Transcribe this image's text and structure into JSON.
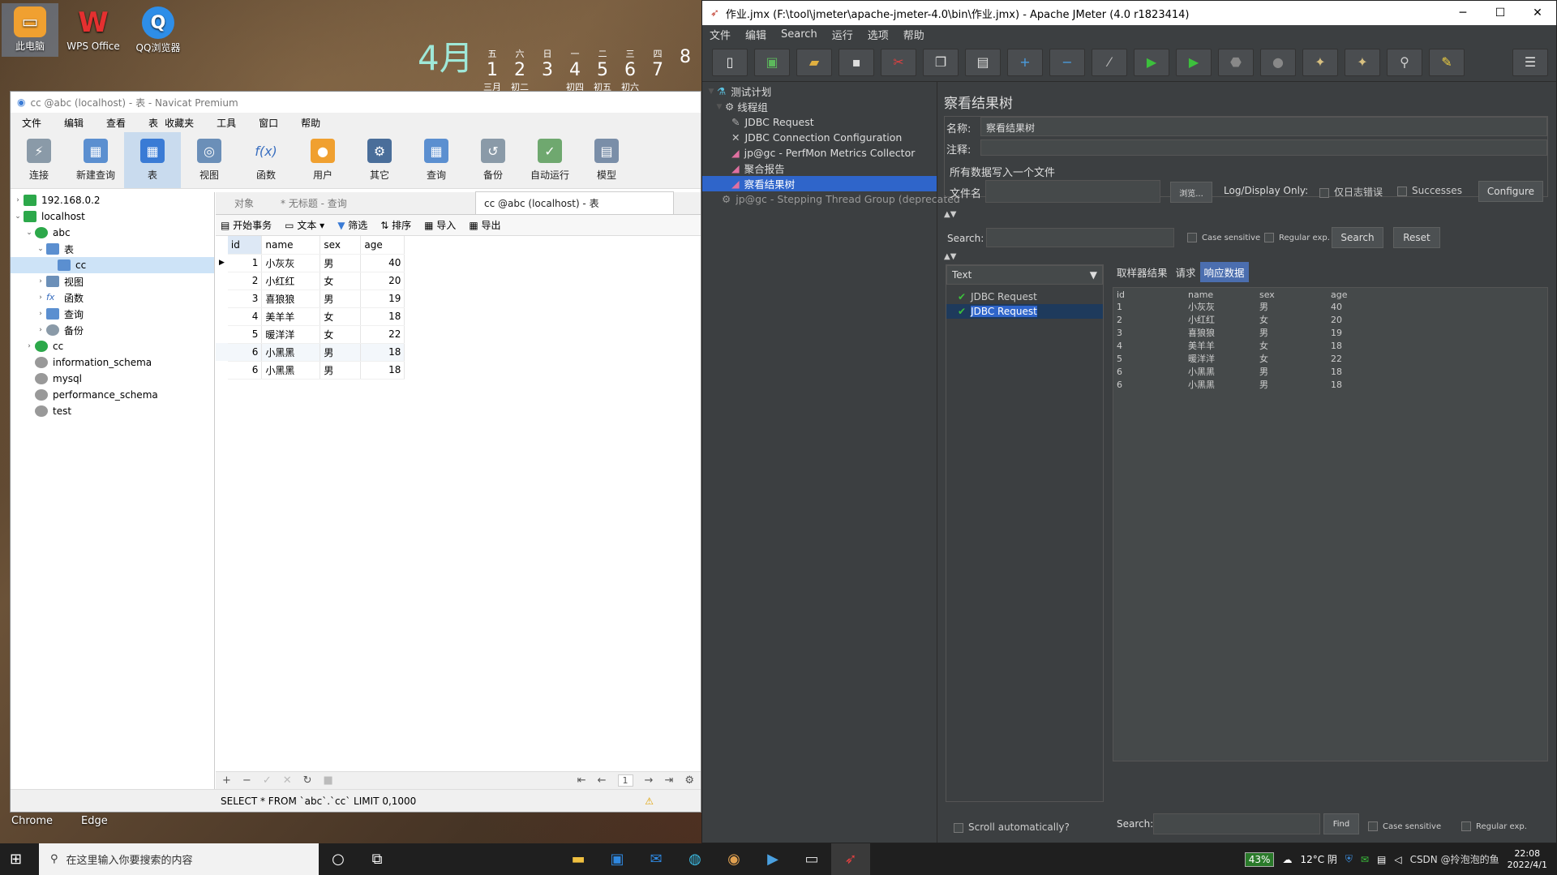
{
  "desktop": {
    "icons": [
      {
        "label": "此电脑"
      },
      {
        "label": "WPS Office"
      },
      {
        "label": "QQ浏览器"
      }
    ],
    "calendar_month": "4月",
    "calendar_days": [
      {
        "top": "五",
        "num": "1",
        "sub": "三月"
      },
      {
        "top": "六",
        "num": "2",
        "sub": "初二"
      },
      {
        "top": "日",
        "num": "3",
        "sub": ""
      },
      {
        "top": "一",
        "num": "4",
        "sub": "初四"
      },
      {
        "top": "二",
        "num": "5",
        "sub": "初五"
      },
      {
        "top": "三",
        "num": "6",
        "sub": "初六"
      },
      {
        "top": "四",
        "num": "7",
        "sub": ""
      },
      {
        "top": "",
        "num": "8",
        "sub": ""
      }
    ],
    "bottom_labels": [
      "Chrome",
      "Edge"
    ]
  },
  "navicat": {
    "title": "cc @abc (localhost) - 表 - Navicat Premium",
    "menu": [
      "文件",
      "编辑",
      "查看",
      "表",
      "收藏夹",
      "工具",
      "窗口",
      "帮助"
    ],
    "tools": [
      "连接",
      "新建查询",
      "表",
      "视图",
      "函数",
      "用户",
      "其它",
      "查询",
      "备份",
      "自动运行",
      "模型"
    ],
    "tree": [
      {
        "label": "192.168.0.2",
        "level": 0,
        "arrow": "›"
      },
      {
        "label": "localhost",
        "level": 0,
        "arrow": "⌄"
      },
      {
        "label": "abc",
        "level": 1,
        "arrow": "⌄"
      },
      {
        "label": "表",
        "level": 2,
        "arrow": "⌄"
      },
      {
        "label": "cc",
        "level": 3,
        "arrow": ""
      },
      {
        "label": "视图",
        "level": 2,
        "arrow": "›"
      },
      {
        "label": "函数",
        "level": 2,
        "arrow": "›"
      },
      {
        "label": "查询",
        "level": 2,
        "arrow": "›"
      },
      {
        "label": "备份",
        "level": 2,
        "arrow": "›"
      },
      {
        "label": "cc",
        "level": 1,
        "arrow": "›"
      },
      {
        "label": "information_schema",
        "level": 1,
        "arrow": ""
      },
      {
        "label": "mysql",
        "level": 1,
        "arrow": ""
      },
      {
        "label": "performance_schema",
        "level": 1,
        "arrow": ""
      },
      {
        "label": "test",
        "level": 1,
        "arrow": ""
      }
    ],
    "tabs": [
      "对象",
      "* 无标题 - 查询",
      "cc @abc (localhost) - 表"
    ],
    "toolbar": [
      "开始事务",
      "文本",
      "筛选",
      "排序",
      "导入",
      "导出"
    ],
    "columns": [
      "id",
      "name",
      "sex",
      "age"
    ],
    "rows": [
      [
        "1",
        "小灰灰",
        "男",
        "40"
      ],
      [
        "2",
        "小红红",
        "女",
        "20"
      ],
      [
        "3",
        "喜狼狼",
        "男",
        "19"
      ],
      [
        "4",
        "美羊羊",
        "女",
        "18"
      ],
      [
        "5",
        "暖洋洋",
        "女",
        "22"
      ],
      [
        "6",
        "小黑黑",
        "男",
        "18"
      ],
      [
        "6",
        "小黑黑",
        "男",
        "18"
      ]
    ],
    "page_number": "1",
    "status_sql": "SELECT * FROM `abc`.`cc` LIMIT 0,1000"
  },
  "jmeter": {
    "title": "作业.jmx (F:\\tool\\jmeter\\apache-jmeter-4.0\\bin\\作业.jmx) - Apache JMeter (4.0 r1823414)",
    "menu": [
      "文件",
      "编辑",
      "Search",
      "运行",
      "选项",
      "帮助"
    ],
    "tree": [
      {
        "label": "测试计划",
        "level": 0
      },
      {
        "label": "线程组",
        "level": 1
      },
      {
        "label": "JDBC Request",
        "level": 2
      },
      {
        "label": "JDBC Connection Configuration",
        "level": 2
      },
      {
        "label": "jp@gc - PerfMon Metrics Collector",
        "level": 2
      },
      {
        "label": "聚合报告",
        "level": 2
      },
      {
        "label": "察看结果树",
        "level": 2
      },
      {
        "label": "jp@gc - Stepping Thread Group (deprecated",
        "level": 1
      }
    ],
    "panel_title": "察看结果树",
    "name_label": "名称:",
    "name_value": "察看结果树",
    "comment_label": "注释:",
    "file_section": "所有数据写入一个文件",
    "file_label": "文件名",
    "browse": "浏览...",
    "log_only": "Log/Display Only:",
    "errors_only": "仅日志错误",
    "successes": "Successes",
    "configure": "Configure",
    "search_label": "Search:",
    "case_sensitive": "Case sensitive",
    "regex": "Regular exp.",
    "search_btn": "Search",
    "reset_btn": "Reset",
    "renderer": "Text",
    "result_tabs": [
      "取样器结果",
      "请求",
      "响应数据"
    ],
    "samples": [
      "JDBC Request",
      "JDBC Request"
    ],
    "resp_columns": [
      "id",
      "name",
      "sex",
      "age"
    ],
    "resp_rows": [
      [
        "1",
        "小灰灰",
        "男",
        "40"
      ],
      [
        "2",
        "小红红",
        "女",
        "20"
      ],
      [
        "3",
        "喜狼狼",
        "男",
        "19"
      ],
      [
        "4",
        "美羊羊",
        "女",
        "18"
      ],
      [
        "5",
        "暖洋洋",
        "女",
        "22"
      ],
      [
        "6",
        "小黑黑",
        "男",
        "18"
      ],
      [
        "6",
        "小黑黑",
        "男",
        "18"
      ]
    ],
    "scroll_auto": "Scroll automatically?",
    "bottom_search": "Search:",
    "find": "Find",
    "bottom_case": "Case sensitive",
    "bottom_regex": "Regular exp."
  },
  "taskbar": {
    "search_placeholder": "在这里输入你要搜索的内容",
    "battery": "43%",
    "weather": "12°C 阴",
    "time": "22:08",
    "date": "2022/4/1",
    "watermark": "CSDN @拎泡泡的鱼"
  }
}
